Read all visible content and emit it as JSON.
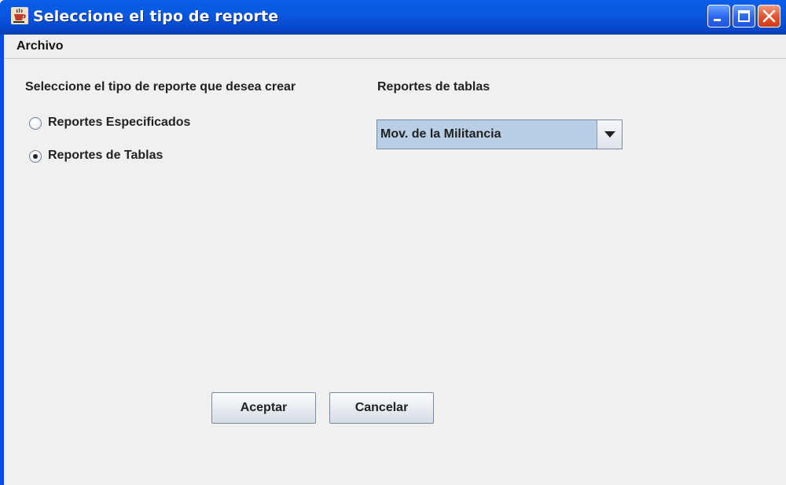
{
  "window": {
    "title": "Seleccione el tipo de reporte",
    "app_icon": "java-cup-icon"
  },
  "menubar": {
    "items": [
      "Archivo"
    ]
  },
  "left_panel": {
    "prompt": "Seleccione el tipo de reporte que desea crear",
    "options": [
      {
        "label": "Reportes Especificados",
        "selected": false
      },
      {
        "label": "Reportes de Tablas",
        "selected": true
      }
    ]
  },
  "right_panel": {
    "label": "Reportes de tablas",
    "combo_value": "Mov. de la Militancia"
  },
  "buttons": {
    "accept": "Aceptar",
    "cancel": "Cancelar"
  },
  "colors": {
    "titlebar": "#0a58e0",
    "window_bg": "#f0f0f0",
    "combo_bg": "#b8cfe5"
  }
}
